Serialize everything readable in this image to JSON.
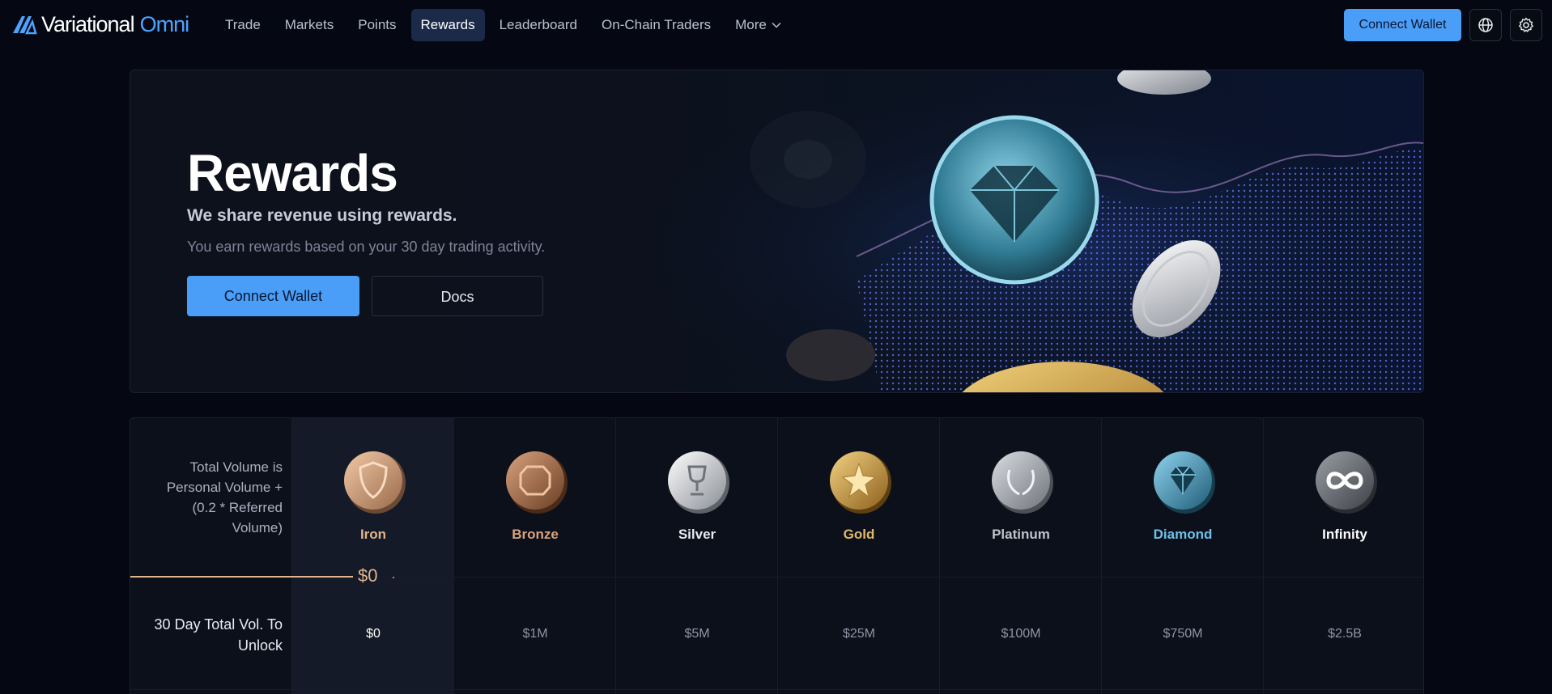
{
  "brand": {
    "name": "Variational",
    "product": "Omni"
  },
  "nav": {
    "items": [
      {
        "label": "Trade",
        "active": false
      },
      {
        "label": "Markets",
        "active": false
      },
      {
        "label": "Points",
        "active": false
      },
      {
        "label": "Rewards",
        "active": true
      },
      {
        "label": "Leaderboard",
        "active": false
      },
      {
        "label": "On-Chain Traders",
        "active": false
      },
      {
        "label": "More",
        "active": false
      }
    ],
    "connect_label": "Connect Wallet"
  },
  "hero": {
    "title": "Rewards",
    "subtitle": "We share revenue using rewards.",
    "description": "You earn rewards based on your 30 day trading activity.",
    "connect_label": "Connect Wallet",
    "docs_label": "Docs"
  },
  "tiers": {
    "volume_note": "Total Volume is Personal Volume + (0.2 * Referred Volume)",
    "unlock_label": "30 Day Total Vol. To Unlock",
    "current_volume": "$0",
    "levels": [
      {
        "name": "Iron",
        "unlock": "$0",
        "color": "#e2b48c",
        "coin": "shield"
      },
      {
        "name": "Bronze",
        "unlock": "$1M",
        "color": "#d9a27c",
        "coin": "octagon"
      },
      {
        "name": "Silver",
        "unlock": "$5M",
        "color": "#e8eaee",
        "coin": "trophy"
      },
      {
        "name": "Gold",
        "unlock": "$25M",
        "color": "#e0b866",
        "coin": "star"
      },
      {
        "name": "Platinum",
        "unlock": "$100M",
        "color": "#bfc3ca",
        "coin": "laurel"
      },
      {
        "name": "Diamond",
        "unlock": "$750M",
        "color": "#6cc2e8",
        "coin": "diamond"
      },
      {
        "name": "Infinity",
        "unlock": "$2.5B",
        "color": "#ffffff",
        "coin": "infinity"
      }
    ]
  },
  "colors": {
    "accent": "#4a9ef8",
    "background": "#050812",
    "panel": "#0c101b"
  }
}
